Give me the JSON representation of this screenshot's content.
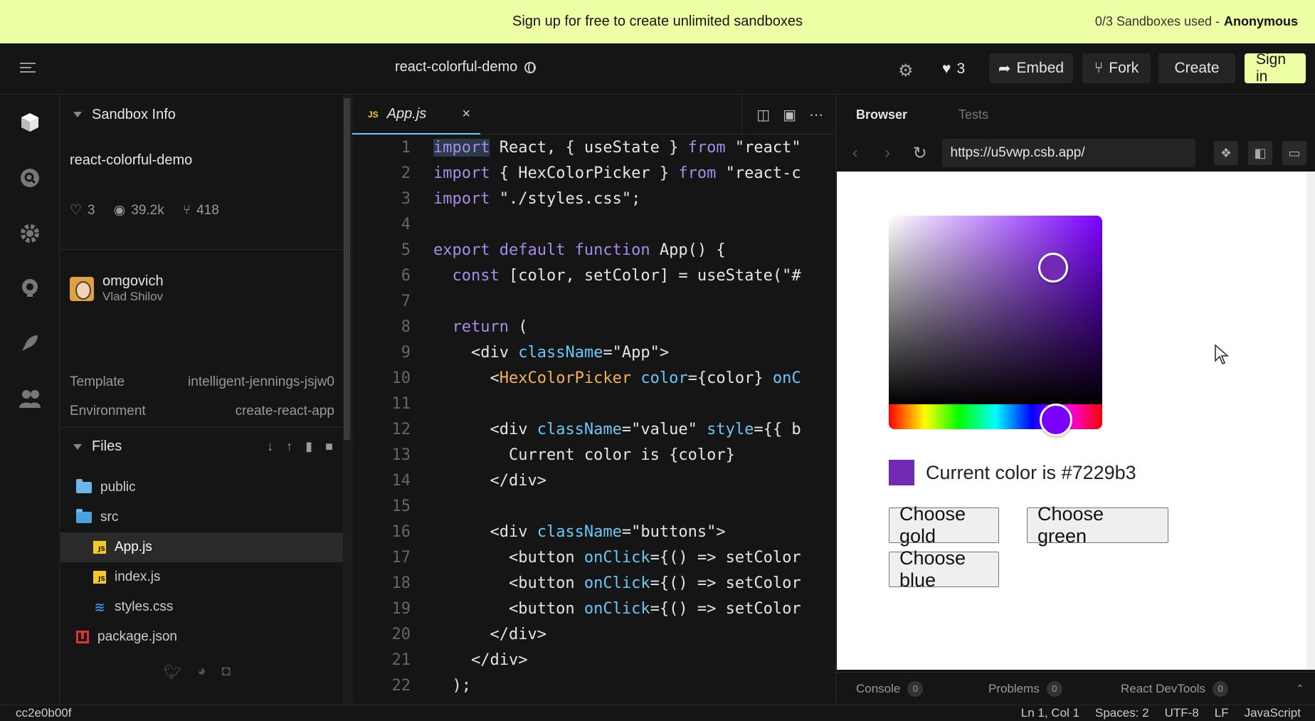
{
  "banner": {
    "message": "Sign up for free to create unlimited sandboxes",
    "usage": "0/3 Sandboxes used -",
    "user": "Anonymous"
  },
  "header": {
    "title": "react-colorful-demo",
    "likes": "3",
    "embed_label": "Embed",
    "fork_label": "Fork",
    "create_label": "Create",
    "signin_label": "Sign in",
    "signin_color": "#edffa5"
  },
  "sidebar": {
    "info_title": "Sandbox Info",
    "sandbox_name": "react-colorful-demo",
    "stats": {
      "likes": "3",
      "views": "39.2k",
      "forks": "418"
    },
    "author": {
      "username": "omgovich",
      "fullname": "Vlad Shilov"
    },
    "template_label": "Template",
    "template_value": "intelligent-jennings-jsjw0",
    "environment_label": "Environment",
    "environment_value": "create-react-app",
    "files_title": "Files",
    "files": [
      {
        "name": "public",
        "type": "folder"
      },
      {
        "name": "src",
        "type": "folder-open"
      },
      {
        "name": "App.js",
        "type": "js"
      },
      {
        "name": "index.js",
        "type": "js"
      },
      {
        "name": "styles.css",
        "type": "css"
      },
      {
        "name": "package.json",
        "type": "package"
      }
    ]
  },
  "editor": {
    "tab_badge": "JS",
    "tab_name": "App.js",
    "close_glyph": "×",
    "lines": [
      {
        "n": "1"
      },
      {
        "n": "2"
      },
      {
        "n": "3"
      },
      {
        "n": "4"
      },
      {
        "n": "5"
      },
      {
        "n": "6"
      },
      {
        "n": "7"
      },
      {
        "n": "8"
      },
      {
        "n": "9"
      },
      {
        "n": "10"
      },
      {
        "n": "11"
      },
      {
        "n": "12"
      },
      {
        "n": "13"
      },
      {
        "n": "14"
      },
      {
        "n": "15"
      },
      {
        "n": "16"
      },
      {
        "n": "17"
      },
      {
        "n": "18"
      },
      {
        "n": "19"
      },
      {
        "n": "20"
      },
      {
        "n": "21"
      },
      {
        "n": "22"
      }
    ],
    "code": {
      "l1": [
        "import",
        " React, { useState } ",
        "from",
        " \"react\""
      ],
      "l2": [
        "import",
        " { HexColorPicker } ",
        "from",
        " \"react-c"
      ],
      "l3": [
        "import",
        " \"./styles.css\";"
      ],
      "l5": [
        "export default function",
        " App() {"
      ],
      "l6": [
        "  ",
        "const",
        " [color, setColor] = useState(\"#"
      ],
      "l8": [
        "  ",
        "return",
        " ("
      ],
      "l9": [
        "    <div ",
        "className",
        "=\"App\">"
      ],
      "l10": [
        "      <",
        "HexColorPicker",
        " ",
        "color",
        "={color} ",
        "onC"
      ],
      "l12": [
        "      <div ",
        "className",
        "=\"value\" ",
        "style",
        "={{ b"
      ],
      "l13": [
        "        Current color is {color}"
      ],
      "l14": [
        "      </div>"
      ],
      "l16": [
        "      <div ",
        "className",
        "=\"buttons\">"
      ],
      "l17": [
        "        <button ",
        "onClick",
        "={() => setColor"
      ],
      "l18": [
        "        <button ",
        "onClick",
        "={() => setColor"
      ],
      "l19": [
        "        <button ",
        "onClick",
        "={() => setColor"
      ],
      "l20": [
        "      </div>"
      ],
      "l21": [
        "    </div>"
      ],
      "l22": [
        "  );"
      ]
    }
  },
  "preview": {
    "tab_browser": "Browser",
    "tab_tests": "Tests",
    "url": "https://u5vwp.csb.app/",
    "current_color_text": "Current color is #7229b3",
    "current_color": "#7229b3",
    "buttons": {
      "gold": "Choose gold",
      "green": "Choose green",
      "blue": "Choose blue"
    },
    "console_label": "Console",
    "console_count": "0",
    "problems_label": "Problems",
    "problems_count": "0",
    "devtools_label": "React DevTools",
    "devtools_count": "0"
  },
  "status": {
    "commit": "cc2e0b00f",
    "position": "Ln 1, Col 1",
    "spaces": "Spaces: 2",
    "encoding": "UTF-8",
    "eol": "LF",
    "language": "JavaScript"
  },
  "icons": {
    "heart": "♥",
    "heart_outline": "♡",
    "eye": "◉",
    "fork": "⑂",
    "gear": "⚙",
    "arrow": "➦",
    "close": "×"
  }
}
